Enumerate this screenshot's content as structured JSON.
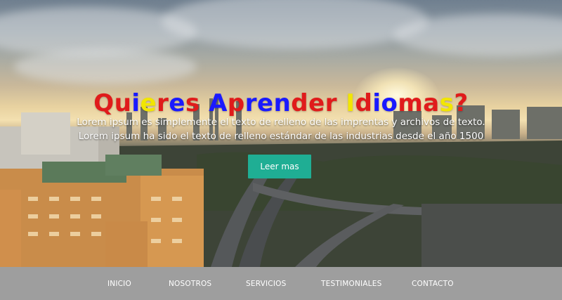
{
  "hero": {
    "title_letters": [
      {
        "ch": "Q",
        "color": "#e01b1b"
      },
      {
        "ch": "u",
        "color": "#e01b1b"
      },
      {
        "ch": "i",
        "color": "#1a1aff"
      },
      {
        "ch": "e",
        "color": "#f2e600"
      },
      {
        "ch": "r",
        "color": "#e01b1b"
      },
      {
        "ch": "e",
        "color": "#1a1aff"
      },
      {
        "ch": "s",
        "color": "#e01b1b"
      },
      {
        "ch": " ",
        "color": "#ffffff"
      },
      {
        "ch": "A",
        "color": "#1a1aff"
      },
      {
        "ch": "p",
        "color": "#e01b1b"
      },
      {
        "ch": "r",
        "color": "#1a1aff"
      },
      {
        "ch": "e",
        "color": "#1a1aff"
      },
      {
        "ch": "n",
        "color": "#1a1aff"
      },
      {
        "ch": "d",
        "color": "#e01b1b"
      },
      {
        "ch": "e",
        "color": "#e01b1b"
      },
      {
        "ch": "r",
        "color": "#e01b1b"
      },
      {
        "ch": " ",
        "color": "#ffffff"
      },
      {
        "ch": "I",
        "color": "#f2e600"
      },
      {
        "ch": "d",
        "color": "#e01b1b"
      },
      {
        "ch": "i",
        "color": "#1a1aff"
      },
      {
        "ch": "o",
        "color": "#1a1aff"
      },
      {
        "ch": "m",
        "color": "#e01b1b"
      },
      {
        "ch": "a",
        "color": "#e01b1b"
      },
      {
        "ch": "s",
        "color": "#f2e600"
      },
      {
        "ch": "?",
        "color": "#e01b1b"
      }
    ],
    "lead_line_1": "Lorem ipsum es simplemente el texto de relleno de las imprentas y archivos de texto.",
    "lead_line_2": "Lorem ipsum ha sido el texto de relleno estándar de las industrias desde el año 1500",
    "cta_label": "Leer mas",
    "cta_color": "#1fae94"
  },
  "nav": {
    "background": "#9e9e9e",
    "items": [
      {
        "label": "INICIO"
      },
      {
        "label": "NOSOTROS"
      },
      {
        "label": "SERVICIOS"
      },
      {
        "label": "TESTIMONIALES"
      },
      {
        "label": "CONTACTO"
      }
    ]
  }
}
